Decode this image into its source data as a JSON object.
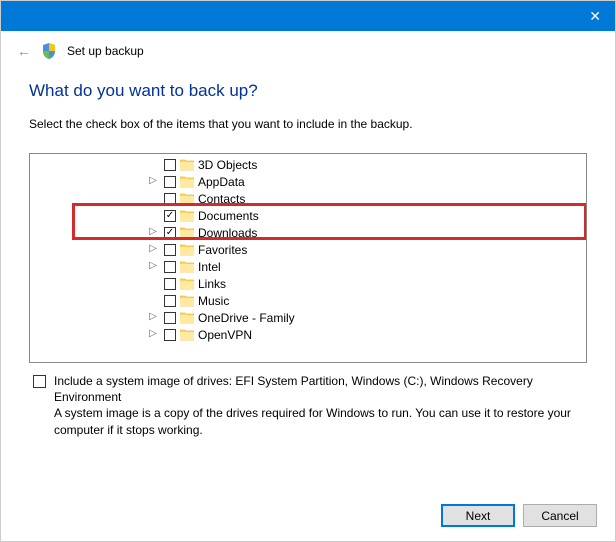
{
  "titlebar": {
    "close": "✕"
  },
  "header": {
    "title": "Set up backup"
  },
  "main": {
    "heading": "What do you want to back up?",
    "instruction": "Select the check box of the items that you want to include in the backup."
  },
  "tree": {
    "items": [
      {
        "label": "3D Objects",
        "checked": false,
        "expandable": false
      },
      {
        "label": "AppData",
        "checked": false,
        "expandable": true
      },
      {
        "label": "Contacts",
        "checked": false,
        "expandable": false
      },
      {
        "label": "Documents",
        "checked": true,
        "expandable": false
      },
      {
        "label": "Downloads",
        "checked": true,
        "expandable": true
      },
      {
        "label": "Favorites",
        "checked": false,
        "expandable": true
      },
      {
        "label": "Intel",
        "checked": false,
        "expandable": true
      },
      {
        "label": "Links",
        "checked": false,
        "expandable": false
      },
      {
        "label": "Music",
        "checked": false,
        "expandable": false
      },
      {
        "label": "OneDrive - Family",
        "checked": false,
        "expandable": true
      },
      {
        "label": "OpenVPN",
        "checked": false,
        "expandable": true
      }
    ]
  },
  "system_image": {
    "label": "Include a system image of drives: EFI System Partition, Windows (C:), Windows Recovery Environment",
    "description": "A system image is a copy of the drives required for Windows to run. You can use it to restore your computer if it stops working."
  },
  "footer": {
    "next": "Next",
    "cancel": "Cancel"
  }
}
